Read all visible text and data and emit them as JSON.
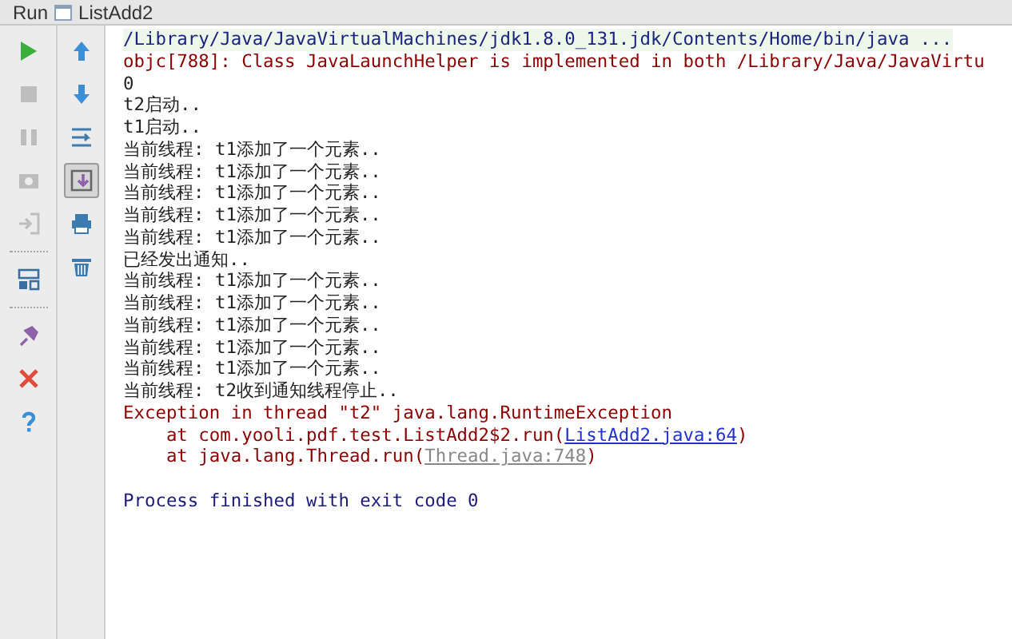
{
  "header": {
    "title": "Run",
    "tab": "ListAdd2"
  },
  "toolbar_left": [
    {
      "kind": "run",
      "disabled": false
    },
    {
      "kind": "stop",
      "disabled": true
    },
    {
      "kind": "pause",
      "disabled": true
    },
    {
      "kind": "camera",
      "disabled": true
    },
    {
      "kind": "exit",
      "disabled": true
    },
    {
      "kind": "separator"
    },
    {
      "kind": "layout",
      "disabled": false
    },
    {
      "kind": "separator"
    },
    {
      "kind": "pin",
      "disabled": false
    },
    {
      "kind": "close",
      "disabled": false
    },
    {
      "kind": "help",
      "disabled": false
    }
  ],
  "toolbar_right": [
    {
      "kind": "up",
      "selected": false
    },
    {
      "kind": "down",
      "selected": false
    },
    {
      "kind": "wrap",
      "selected": false
    },
    {
      "kind": "scroll-end",
      "selected": true
    },
    {
      "kind": "print",
      "selected": false
    },
    {
      "kind": "trash",
      "selected": false
    }
  ],
  "console": [
    {
      "kind": "command",
      "text": "/Library/Java/JavaVirtualMachines/jdk1.8.0_131.jdk/Contents/Home/bin/java ..."
    },
    {
      "kind": "error",
      "text": "objc[788]: Class JavaLaunchHelper is implemented in both /Library/Java/JavaVirtu"
    },
    {
      "kind": "output",
      "text": "0"
    },
    {
      "kind": "output",
      "text": "t2启动.."
    },
    {
      "kind": "output",
      "text": "t1启动.."
    },
    {
      "kind": "output",
      "text": "当前线程: t1添加了一个元素.."
    },
    {
      "kind": "output",
      "text": "当前线程: t1添加了一个元素.."
    },
    {
      "kind": "output",
      "text": "当前线程: t1添加了一个元素.."
    },
    {
      "kind": "output",
      "text": "当前线程: t1添加了一个元素.."
    },
    {
      "kind": "output",
      "text": "当前线程: t1添加了一个元素.."
    },
    {
      "kind": "output",
      "text": "已经发出通知.."
    },
    {
      "kind": "output",
      "text": "当前线程: t1添加了一个元素.."
    },
    {
      "kind": "output",
      "text": "当前线程: t1添加了一个元素.."
    },
    {
      "kind": "output",
      "text": "当前线程: t1添加了一个元素.."
    },
    {
      "kind": "output",
      "text": "当前线程: t1添加了一个元素.."
    },
    {
      "kind": "output",
      "text": "当前线程: t1添加了一个元素.."
    },
    {
      "kind": "output",
      "text": "当前线程: t2收到通知线程停止.."
    },
    {
      "kind": "error",
      "text": "Exception in thread \"t2\" java.lang.RuntimeException"
    },
    {
      "kind": "stack",
      "prefix": "    at com.yooli.pdf.test.ListAdd2$2.run(",
      "link": "ListAdd2.java:64",
      "greyed": false,
      "suffix": ")"
    },
    {
      "kind": "stack",
      "prefix": "    at java.lang.Thread.run(",
      "link": "Thread.java:748",
      "greyed": true,
      "suffix": ")"
    },
    {
      "kind": "blank"
    },
    {
      "kind": "system",
      "text": "Process finished with exit code 0"
    }
  ]
}
